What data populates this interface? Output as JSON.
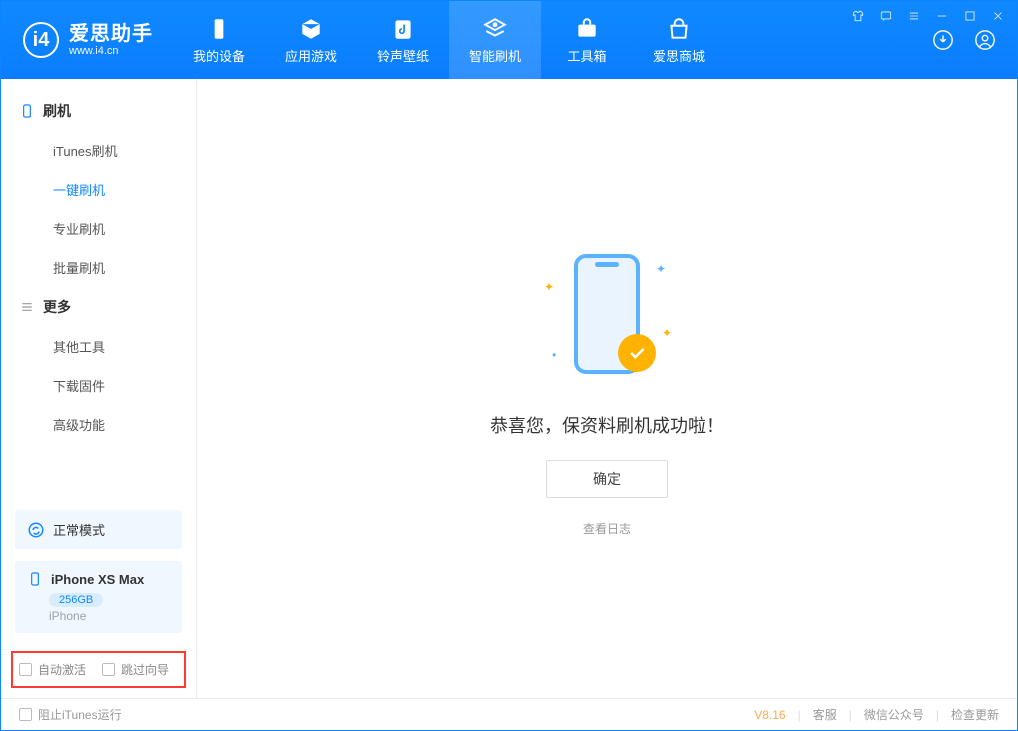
{
  "app": {
    "title": "爱思助手",
    "url": "www.i4.cn"
  },
  "nav": {
    "items": [
      {
        "label": "我的设备",
        "icon": "device"
      },
      {
        "label": "应用游戏",
        "icon": "cube"
      },
      {
        "label": "铃声壁纸",
        "icon": "music"
      },
      {
        "label": "智能刷机",
        "icon": "refresh",
        "active": true
      },
      {
        "label": "工具箱",
        "icon": "toolbox"
      },
      {
        "label": "爱思商城",
        "icon": "store"
      }
    ]
  },
  "sidebar": {
    "groups": [
      {
        "title": "刷机",
        "icon": "phone",
        "items": [
          "iTunes刷机",
          "一键刷机",
          "专业刷机",
          "批量刷机"
        ],
        "activeIndex": 1
      },
      {
        "title": "更多",
        "icon": "menu",
        "items": [
          "其他工具",
          "下载固件",
          "高级功能"
        ]
      }
    ],
    "mode": {
      "label": "正常模式"
    },
    "device": {
      "name": "iPhone XS Max",
      "storage": "256GB",
      "type": "iPhone"
    },
    "options": {
      "auto_activate": "自动激活",
      "skip_guide": "跳过向导"
    }
  },
  "main": {
    "success_text": "恭喜您，保资料刷机成功啦！",
    "ok_button": "确定",
    "view_log": "查看日志"
  },
  "footer": {
    "block_itunes": "阻止iTunes运行",
    "version": "V8.16",
    "links": [
      "客服",
      "微信公众号",
      "检查更新"
    ]
  }
}
